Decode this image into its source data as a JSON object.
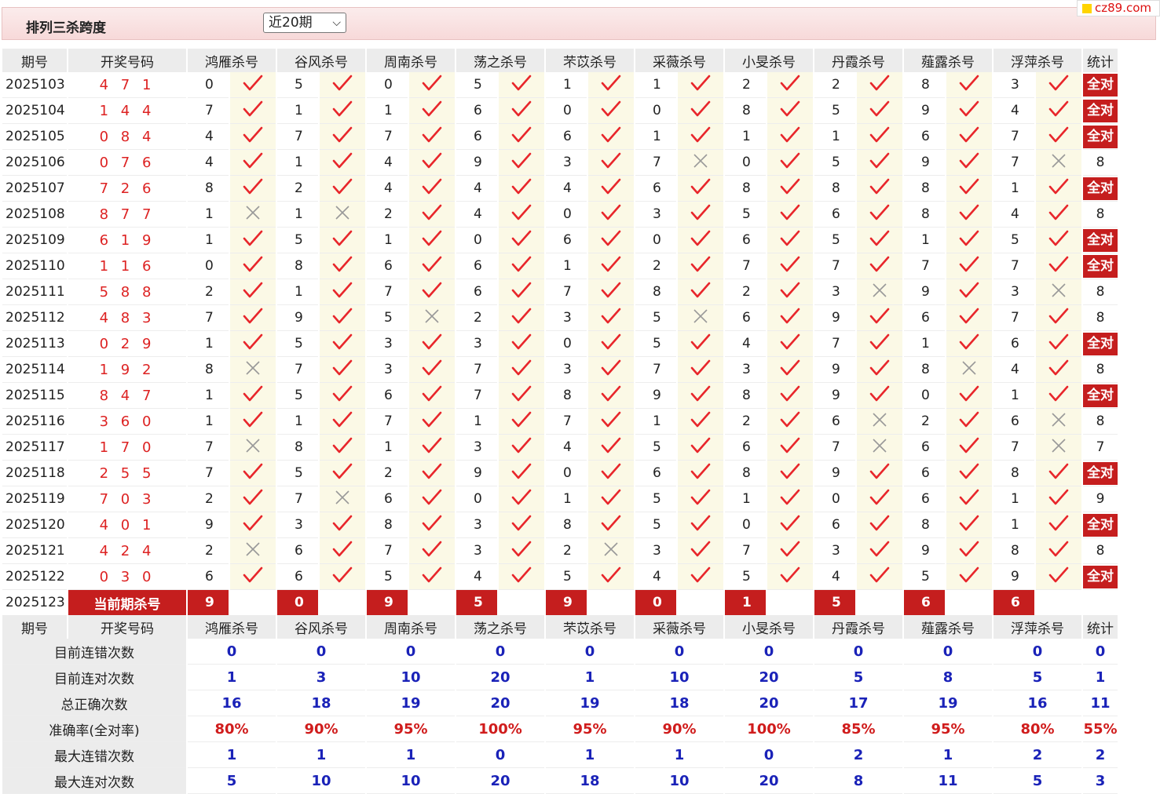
{
  "header": {
    "title": "排列三杀跨度",
    "period_select": "近20期",
    "logo": "cz89.com"
  },
  "columns": [
    "期号",
    "开奖号码",
    "鸿雁杀号",
    "谷风杀号",
    "周南杀号",
    "荡之杀号",
    "芣苡杀号",
    "采薇杀号",
    "小旻杀号",
    "丹霞杀号",
    "薤露杀号",
    "浮萍杀号",
    "统计"
  ],
  "rows": [
    {
      "issue": "2025103",
      "draw": "4 7 1",
      "kills": [
        [
          "0",
          1
        ],
        [
          "5",
          1
        ],
        [
          "0",
          1
        ],
        [
          "5",
          1
        ],
        [
          "1",
          1
        ],
        [
          "1",
          1
        ],
        [
          "2",
          1
        ],
        [
          "2",
          1
        ],
        [
          "8",
          1
        ],
        [
          "3",
          1
        ]
      ],
      "stat": "全对"
    },
    {
      "issue": "2025104",
      "draw": "1 4 4",
      "kills": [
        [
          "7",
          1
        ],
        [
          "1",
          1
        ],
        [
          "1",
          1
        ],
        [
          "6",
          1
        ],
        [
          "0",
          1
        ],
        [
          "0",
          1
        ],
        [
          "8",
          1
        ],
        [
          "5",
          1
        ],
        [
          "9",
          1
        ],
        [
          "4",
          1
        ]
      ],
      "stat": "全对"
    },
    {
      "issue": "2025105",
      "draw": "0 8 4",
      "kills": [
        [
          "4",
          1
        ],
        [
          "7",
          1
        ],
        [
          "7",
          1
        ],
        [
          "6",
          1
        ],
        [
          "6",
          1
        ],
        [
          "1",
          1
        ],
        [
          "1",
          1
        ],
        [
          "1",
          1
        ],
        [
          "6",
          1
        ],
        [
          "7",
          1
        ]
      ],
      "stat": "全对"
    },
    {
      "issue": "2025106",
      "draw": "0 7 6",
      "kills": [
        [
          "4",
          1
        ],
        [
          "1",
          1
        ],
        [
          "4",
          1
        ],
        [
          "9",
          1
        ],
        [
          "3",
          1
        ],
        [
          "7",
          0
        ],
        [
          "0",
          1
        ],
        [
          "5",
          1
        ],
        [
          "9",
          1
        ],
        [
          "7",
          0
        ]
      ],
      "stat": "8"
    },
    {
      "issue": "2025107",
      "draw": "7 2 6",
      "kills": [
        [
          "8",
          1
        ],
        [
          "2",
          1
        ],
        [
          "4",
          1
        ],
        [
          "4",
          1
        ],
        [
          "4",
          1
        ],
        [
          "6",
          1
        ],
        [
          "8",
          1
        ],
        [
          "8",
          1
        ],
        [
          "8",
          1
        ],
        [
          "1",
          1
        ]
      ],
      "stat": "全对"
    },
    {
      "issue": "2025108",
      "draw": "8 7 7",
      "kills": [
        [
          "1",
          0
        ],
        [
          "1",
          0
        ],
        [
          "2",
          1
        ],
        [
          "4",
          1
        ],
        [
          "0",
          1
        ],
        [
          "3",
          1
        ],
        [
          "5",
          1
        ],
        [
          "6",
          1
        ],
        [
          "8",
          1
        ],
        [
          "4",
          1
        ]
      ],
      "stat": "8"
    },
    {
      "issue": "2025109",
      "draw": "6 1 9",
      "kills": [
        [
          "1",
          1
        ],
        [
          "5",
          1
        ],
        [
          "1",
          1
        ],
        [
          "0",
          1
        ],
        [
          "6",
          1
        ],
        [
          "0",
          1
        ],
        [
          "6",
          1
        ],
        [
          "5",
          1
        ],
        [
          "1",
          1
        ],
        [
          "5",
          1
        ]
      ],
      "stat": "全对"
    },
    {
      "issue": "2025110",
      "draw": "1 1 6",
      "kills": [
        [
          "0",
          1
        ],
        [
          "8",
          1
        ],
        [
          "6",
          1
        ],
        [
          "6",
          1
        ],
        [
          "1",
          1
        ],
        [
          "2",
          1
        ],
        [
          "7",
          1
        ],
        [
          "7",
          1
        ],
        [
          "7",
          1
        ],
        [
          "7",
          1
        ]
      ],
      "stat": "全对"
    },
    {
      "issue": "2025111",
      "draw": "5 8 8",
      "kills": [
        [
          "2",
          1
        ],
        [
          "1",
          1
        ],
        [
          "7",
          1
        ],
        [
          "6",
          1
        ],
        [
          "7",
          1
        ],
        [
          "8",
          1
        ],
        [
          "2",
          1
        ],
        [
          "3",
          0
        ],
        [
          "9",
          1
        ],
        [
          "3",
          0
        ]
      ],
      "stat": "8"
    },
    {
      "issue": "2025112",
      "draw": "4 8 3",
      "kills": [
        [
          "7",
          1
        ],
        [
          "9",
          1
        ],
        [
          "5",
          0
        ],
        [
          "2",
          1
        ],
        [
          "3",
          1
        ],
        [
          "5",
          0
        ],
        [
          "6",
          1
        ],
        [
          "9",
          1
        ],
        [
          "6",
          1
        ],
        [
          "7",
          1
        ]
      ],
      "stat": "8"
    },
    {
      "issue": "2025113",
      "draw": "0 2 9",
      "kills": [
        [
          "1",
          1
        ],
        [
          "5",
          1
        ],
        [
          "3",
          1
        ],
        [
          "3",
          1
        ],
        [
          "0",
          1
        ],
        [
          "5",
          1
        ],
        [
          "4",
          1
        ],
        [
          "7",
          1
        ],
        [
          "1",
          1
        ],
        [
          "6",
          1
        ]
      ],
      "stat": "全对"
    },
    {
      "issue": "2025114",
      "draw": "1 9 2",
      "kills": [
        [
          "8",
          0
        ],
        [
          "7",
          1
        ],
        [
          "3",
          1
        ],
        [
          "7",
          1
        ],
        [
          "3",
          1
        ],
        [
          "7",
          1
        ],
        [
          "3",
          1
        ],
        [
          "9",
          1
        ],
        [
          "8",
          0
        ],
        [
          "4",
          1
        ]
      ],
      "stat": "8"
    },
    {
      "issue": "2025115",
      "draw": "8 4 7",
      "kills": [
        [
          "1",
          1
        ],
        [
          "5",
          1
        ],
        [
          "6",
          1
        ],
        [
          "7",
          1
        ],
        [
          "8",
          1
        ],
        [
          "9",
          1
        ],
        [
          "8",
          1
        ],
        [
          "9",
          1
        ],
        [
          "0",
          1
        ],
        [
          "1",
          1
        ]
      ],
      "stat": "全对"
    },
    {
      "issue": "2025116",
      "draw": "3 6 0",
      "kills": [
        [
          "1",
          1
        ],
        [
          "1",
          1
        ],
        [
          "7",
          1
        ],
        [
          "1",
          1
        ],
        [
          "7",
          1
        ],
        [
          "1",
          1
        ],
        [
          "2",
          1
        ],
        [
          "6",
          0
        ],
        [
          "2",
          1
        ],
        [
          "6",
          0
        ]
      ],
      "stat": "8"
    },
    {
      "issue": "2025117",
      "draw": "1 7 0",
      "kills": [
        [
          "7",
          0
        ],
        [
          "8",
          1
        ],
        [
          "1",
          1
        ],
        [
          "3",
          1
        ],
        [
          "4",
          1
        ],
        [
          "5",
          1
        ],
        [
          "6",
          1
        ],
        [
          "7",
          0
        ],
        [
          "6",
          1
        ],
        [
          "7",
          0
        ]
      ],
      "stat": "7"
    },
    {
      "issue": "2025118",
      "draw": "2 5 5",
      "kills": [
        [
          "7",
          1
        ],
        [
          "5",
          1
        ],
        [
          "2",
          1
        ],
        [
          "9",
          1
        ],
        [
          "0",
          1
        ],
        [
          "6",
          1
        ],
        [
          "8",
          1
        ],
        [
          "9",
          1
        ],
        [
          "6",
          1
        ],
        [
          "8",
          1
        ]
      ],
      "stat": "全对"
    },
    {
      "issue": "2025119",
      "draw": "7 0 3",
      "kills": [
        [
          "2",
          1
        ],
        [
          "7",
          0
        ],
        [
          "6",
          1
        ],
        [
          "0",
          1
        ],
        [
          "1",
          1
        ],
        [
          "5",
          1
        ],
        [
          "1",
          1
        ],
        [
          "0",
          1
        ],
        [
          "6",
          1
        ],
        [
          "1",
          1
        ]
      ],
      "stat": "9"
    },
    {
      "issue": "2025120",
      "draw": "4 0 1",
      "kills": [
        [
          "9",
          1
        ],
        [
          "3",
          1
        ],
        [
          "8",
          1
        ],
        [
          "3",
          1
        ],
        [
          "8",
          1
        ],
        [
          "5",
          1
        ],
        [
          "0",
          1
        ],
        [
          "6",
          1
        ],
        [
          "8",
          1
        ],
        [
          "1",
          1
        ]
      ],
      "stat": "全对"
    },
    {
      "issue": "2025121",
      "draw": "4 2 4",
      "kills": [
        [
          "2",
          0
        ],
        [
          "6",
          1
        ],
        [
          "7",
          1
        ],
        [
          "3",
          1
        ],
        [
          "2",
          0
        ],
        [
          "3",
          1
        ],
        [
          "7",
          1
        ],
        [
          "3",
          1
        ],
        [
          "9",
          1
        ],
        [
          "8",
          1
        ]
      ],
      "stat": "8"
    },
    {
      "issue": "2025122",
      "draw": "0 3 0",
      "kills": [
        [
          "6",
          1
        ],
        [
          "6",
          1
        ],
        [
          "5",
          1
        ],
        [
          "4",
          1
        ],
        [
          "5",
          1
        ],
        [
          "4",
          1
        ],
        [
          "5",
          1
        ],
        [
          "4",
          1
        ],
        [
          "5",
          1
        ],
        [
          "9",
          1
        ]
      ],
      "stat": "全对"
    }
  ],
  "current": {
    "issue": "2025123",
    "label": "当前期杀号",
    "kills": [
      "9",
      "0",
      "9",
      "5",
      "9",
      "0",
      "1",
      "5",
      "6",
      "6"
    ]
  },
  "stats": [
    {
      "label": "目前连错次数",
      "values": [
        "0",
        "0",
        "0",
        "0",
        "0",
        "0",
        "0",
        "0",
        "0",
        "0",
        "0"
      ],
      "kind": "stat"
    },
    {
      "label": "目前连对次数",
      "values": [
        "1",
        "3",
        "10",
        "20",
        "1",
        "10",
        "20",
        "5",
        "8",
        "5",
        "1"
      ],
      "kind": "stat"
    },
    {
      "label": "总正确次数",
      "values": [
        "16",
        "18",
        "19",
        "20",
        "19",
        "18",
        "20",
        "17",
        "19",
        "16",
        "11"
      ],
      "kind": "stat"
    },
    {
      "label": "准确率(全对率)",
      "values": [
        "80%",
        "90%",
        "95%",
        "100%",
        "95%",
        "90%",
        "100%",
        "85%",
        "95%",
        "80%",
        "55%"
      ],
      "kind": "rate"
    },
    {
      "label": "最大连错次数",
      "values": [
        "1",
        "1",
        "1",
        "0",
        "1",
        "1",
        "0",
        "2",
        "1",
        "2",
        "2"
      ],
      "kind": "stat"
    },
    {
      "label": "最大连对次数",
      "values": [
        "5",
        "10",
        "10",
        "20",
        "18",
        "10",
        "20",
        "8",
        "11",
        "5",
        "3"
      ],
      "kind": "stat"
    }
  ],
  "colors": {
    "accent": "#c51e1e",
    "draw": "#dd2222",
    "stat": "#1a22b8",
    "check": "#e8262b",
    "cross": "#999999"
  }
}
